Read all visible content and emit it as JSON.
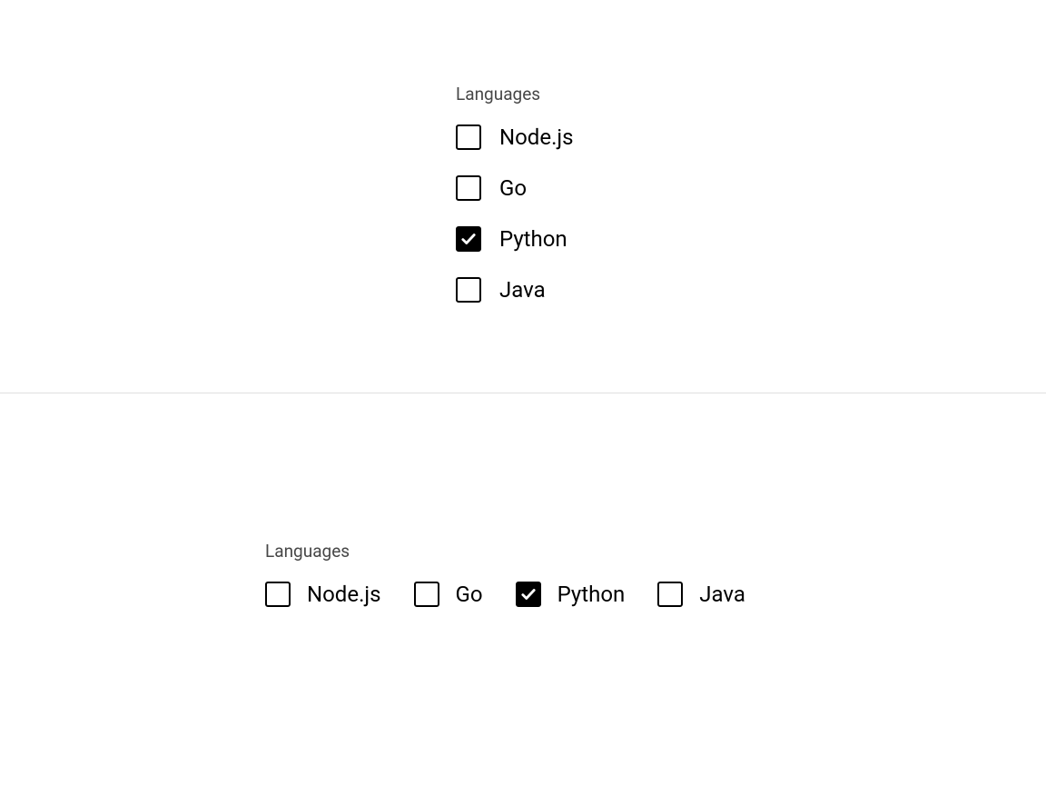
{
  "group1": {
    "legend": "Languages",
    "items": [
      {
        "label": "Node.js",
        "checked": false
      },
      {
        "label": "Go",
        "checked": false
      },
      {
        "label": "Python",
        "checked": true
      },
      {
        "label": "Java",
        "checked": false
      }
    ]
  },
  "group2": {
    "legend": "Languages",
    "items": [
      {
        "label": "Node.js",
        "checked": false
      },
      {
        "label": "Go",
        "checked": false
      },
      {
        "label": "Python",
        "checked": true
      },
      {
        "label": "Java",
        "checked": false
      }
    ]
  }
}
